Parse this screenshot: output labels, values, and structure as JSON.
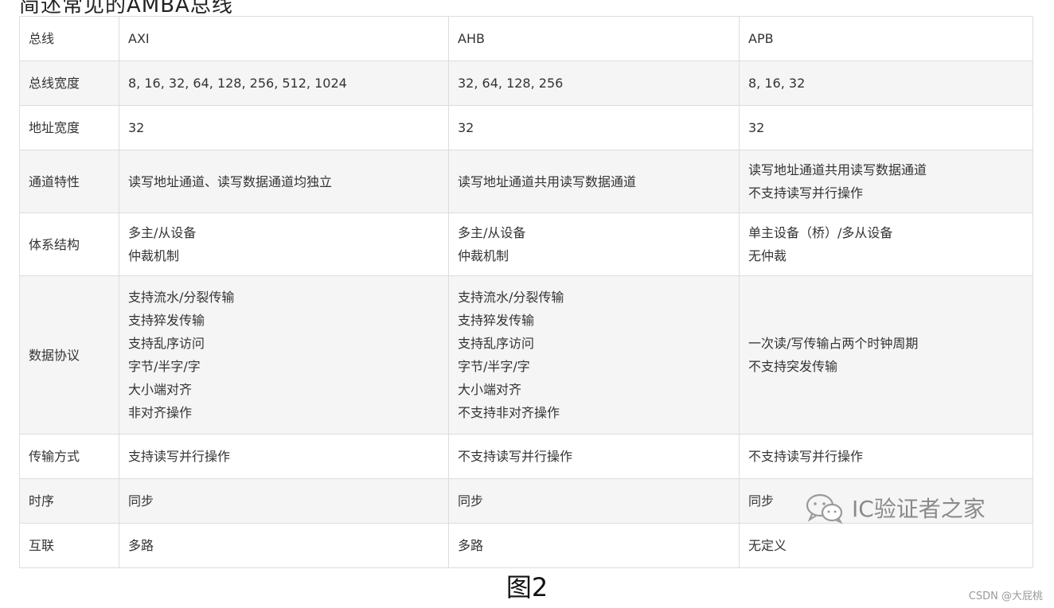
{
  "cut_text": "简述常见的AMBA总线",
  "table": {
    "rows": [
      {
        "label": "总线",
        "cells": [
          [
            "AXI"
          ],
          [
            "AHB"
          ],
          [
            "APB"
          ]
        ]
      },
      {
        "label": "总线宽度",
        "cells": [
          [
            "8, 16, 32, 64, 128, 256, 512, 1024"
          ],
          [
            "32, 64, 128, 256"
          ],
          [
            "8, 16, 32"
          ]
        ]
      },
      {
        "label": "地址宽度",
        "cells": [
          [
            "32"
          ],
          [
            "32"
          ],
          [
            "32"
          ]
        ]
      },
      {
        "label": "通道特性",
        "cells": [
          [
            "读写地址通道、读写数据通道均独立"
          ],
          [
            "读写地址通道共用读写数据通道"
          ],
          [
            "读写地址通道共用读写数据通道",
            "不支持读写并行操作"
          ]
        ]
      },
      {
        "label": "体系结构",
        "cells": [
          [
            "多主/从设备",
            "仲裁机制"
          ],
          [
            "多主/从设备",
            "仲裁机制"
          ],
          [
            "单主设备（桥）/多从设备",
            "无仲裁"
          ]
        ]
      },
      {
        "label": "数据协议",
        "cells": [
          [
            "支持流水/分裂传输",
            "支持猝发传输",
            "支持乱序访问",
            "字节/半字/字",
            "大小端对齐",
            "非对齐操作"
          ],
          [
            "支持流水/分裂传输",
            "支持猝发传输",
            "支持乱序访问",
            "字节/半字/字",
            "大小端对齐",
            "不支持非对齐操作"
          ],
          [
            "一次读/写传输占两个时钟周期",
            "不支持突发传输"
          ]
        ]
      },
      {
        "label": "传输方式",
        "cells": [
          [
            "支持读写并行操作"
          ],
          [
            "不支持读写并行操作"
          ],
          [
            "不支持读写并行操作"
          ]
        ]
      },
      {
        "label": "时序",
        "cells": [
          [
            "同步"
          ],
          [
            "同步"
          ],
          [
            "同步"
          ]
        ]
      },
      {
        "label": "互联",
        "cells": [
          [
            "多路"
          ],
          [
            "多路"
          ],
          [
            "无定义"
          ]
        ]
      }
    ]
  },
  "watermark": {
    "text": "IC验证者之家",
    "icon": "wechat-icon"
  },
  "caption": "图2",
  "credit": "CSDN @大屁桃"
}
